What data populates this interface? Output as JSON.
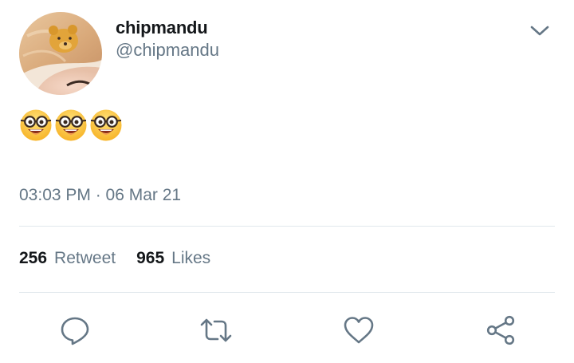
{
  "tweet": {
    "display_name": "chipmandu",
    "handle": "@chipmandu",
    "content_emoji": [
      "nerd-face",
      "nerd-face",
      "nerd-face"
    ],
    "timestamp": "03:03 PM · 06 Mar 21",
    "stats": {
      "retweet_count": "256",
      "retweet_label": "Retweet",
      "likes_count": "965",
      "likes_label": "Likes"
    },
    "actions": [
      "reply-icon",
      "retweet-icon",
      "like-icon",
      "share-icon"
    ]
  },
  "colors": {
    "secondary_text": "#657786",
    "primary_text": "#14171a",
    "divider": "#e1e8ed"
  }
}
